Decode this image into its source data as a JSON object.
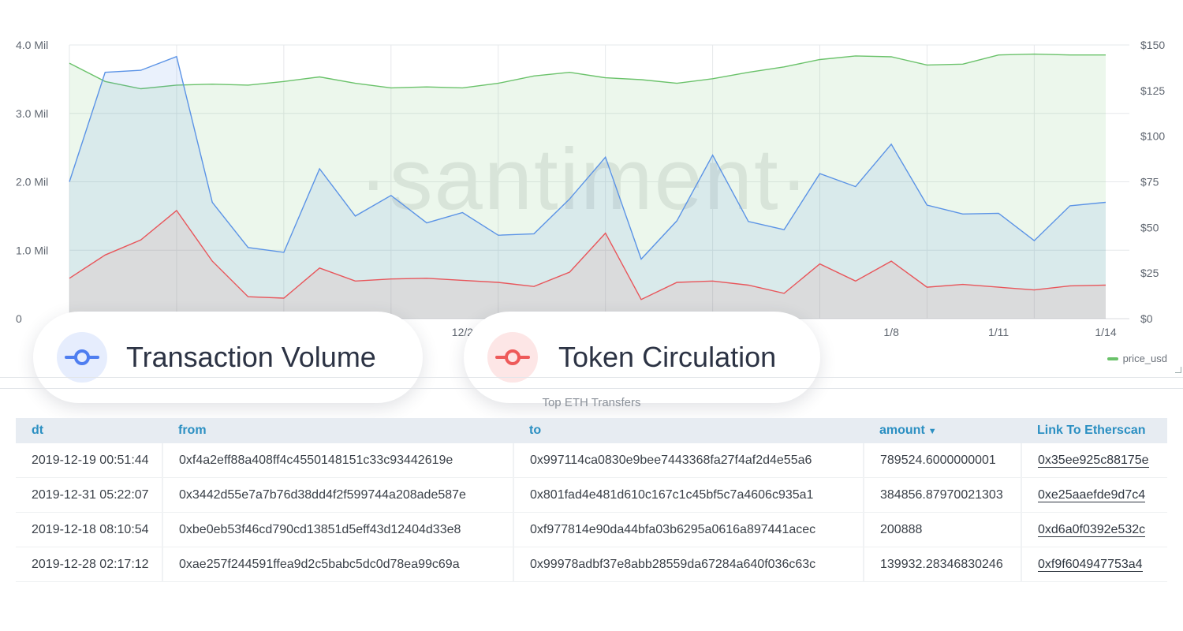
{
  "chart_data": {
    "type": "area",
    "x_ticks": [
      "12/2",
      "1/8",
      "1/11",
      "1/14"
    ],
    "y_left_ticks": [
      "4.0 Mil",
      "3.0 Mil",
      "2.0 Mil",
      "1.0 Mil",
      "0"
    ],
    "y_right_ticks": [
      "$150",
      "$125",
      "$100",
      "$75",
      "$50",
      "$25",
      "$0"
    ],
    "ylim_left": [
      0,
      4000000
    ],
    "ylim_right": [
      0,
      150
    ],
    "series": [
      {
        "name": "price_usd",
        "axis": "right",
        "color": "#6ac26a",
        "values": [
          140,
          130,
          126,
          128,
          128.5,
          128,
          130,
          132.5,
          129,
          126.5,
          127,
          126.5,
          129,
          133,
          135,
          132,
          131,
          129,
          131.5,
          135,
          138,
          142,
          144,
          143.5,
          139,
          139.5,
          144.5,
          145,
          144.5,
          144.5
        ]
      },
      {
        "name": "Transaction Volume",
        "axis": "left",
        "color": "#5b93e6",
        "values": [
          2000000,
          3600000,
          3630000,
          3830000,
          1700000,
          1040000,
          970000,
          2190000,
          1500000,
          1800000,
          1400000,
          1550000,
          1220000,
          1240000,
          1750000,
          2360000,
          870000,
          1430000,
          2390000,
          1420000,
          1300000,
          2120000,
          1930000,
          2550000,
          1660000,
          1530000,
          1540000,
          1140000,
          1650000,
          1700000
        ]
      },
      {
        "name": "Token Circulation",
        "axis": "left",
        "color": "#e8565b",
        "values": [
          590000,
          930000,
          1150000,
          1580000,
          840000,
          320000,
          300000,
          740000,
          550000,
          580000,
          590000,
          560000,
          530000,
          470000,
          680000,
          1250000,
          280000,
          530000,
          550000,
          490000,
          370000,
          800000,
          550000,
          840000,
          460000,
          500000,
          460000,
          420000,
          480000,
          490000
        ]
      }
    ],
    "watermark": "·santiment·"
  },
  "legend": {
    "price_label": "price_usd"
  },
  "pills": [
    {
      "label": "Transaction Volume",
      "color": "#4f7ef0",
      "bg": "#e6edfd"
    },
    {
      "label": "Token Circulation",
      "color": "#ee5a5a",
      "bg": "#fde6e6"
    }
  ],
  "table": {
    "title": "Top ETH Transfers",
    "columns": [
      "dt",
      "from",
      "to",
      "amount",
      "Link To Etherscan"
    ],
    "sort_indicator": "▼",
    "rows": [
      [
        "2019-12-19 00:51:44",
        "0xf4a2eff88a408ff4c4550148151c33c93442619e",
        "0x997114ca0830e9bee7443368fa27f4af2d4e55a6",
        "789524.6000000001",
        "0x35ee925c88175e"
      ],
      [
        "2019-12-31 05:22:07",
        "0x3442d55e7a7b76d38dd4f2f599744a208ade587e",
        "0x801fad4e481d610c167c1c45bf5c7a4606c935a1",
        "384856.87970021303",
        "0xe25aaefde9d7c4"
      ],
      [
        "2019-12-18 08:10:54",
        "0xbe0eb53f46cd790cd13851d5eff43d12404d33e8",
        "0xf977814e90da44bfa03b6295a0616a897441acec",
        "200888",
        "0xd6a0f0392e532c"
      ],
      [
        "2019-12-28 02:17:12",
        "0xae257f244591ffea9d2c5babc5dc0d78ea99c69a",
        "0x99978adbf37e8abb28559da67284a640f036c63c",
        "139932.28346830246",
        "0xf9f604947753a4"
      ]
    ]
  }
}
